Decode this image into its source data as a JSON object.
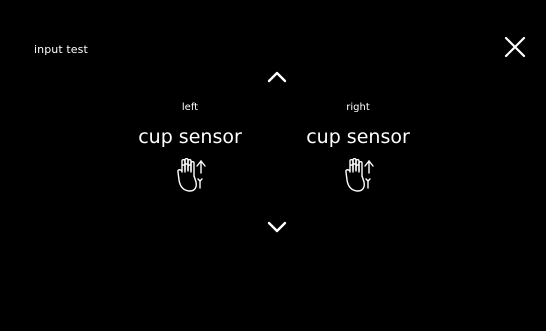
{
  "header": {
    "title": "input test",
    "close_icon": "close-icon"
  },
  "navigation": {
    "up_icon": "chevron-up-icon",
    "down_icon": "chevron-down-icon"
  },
  "sensors": [
    {
      "side": "left",
      "label": "cup sensor",
      "icon": "hand-touch-icon"
    },
    {
      "side": "right",
      "label": "cup sensor",
      "icon": "hand-touch-icon"
    }
  ],
  "colors": {
    "background": "#000000",
    "foreground": "#ffffff"
  }
}
